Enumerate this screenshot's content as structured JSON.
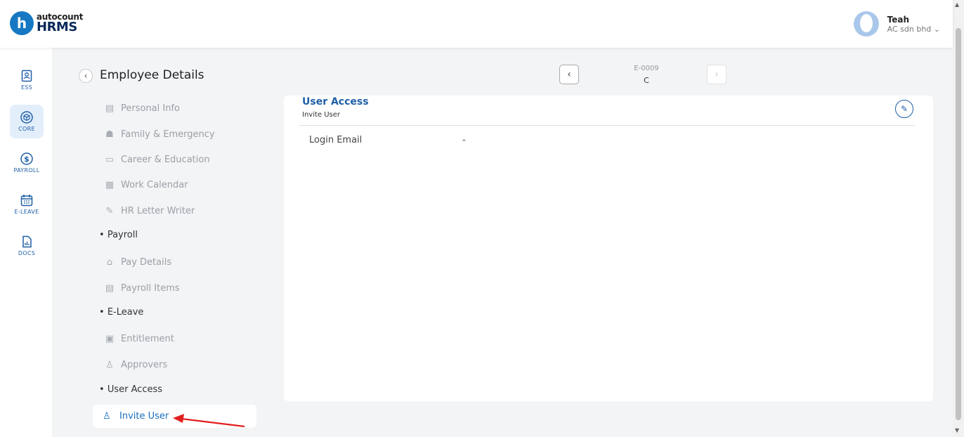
{
  "app": {
    "logo_letter": "h",
    "logo_sub": "autocount",
    "logo_main": "HRMS"
  },
  "user": {
    "name": "Teah",
    "company": "AC sdn bhd ⌄"
  },
  "rail": [
    {
      "label": "ESS",
      "icon": "ess-icon"
    },
    {
      "label": "CORE",
      "icon": "core-cube-icon",
      "active": true
    },
    {
      "label": "PAYROLL",
      "icon": "dollar-icon"
    },
    {
      "label": "E-LEAVE",
      "icon": "calendar-icon"
    },
    {
      "label": "DOCS",
      "icon": "docs-icon"
    }
  ],
  "page": {
    "title": "Employee Details"
  },
  "employee_nav": {
    "code": "E-0009",
    "name": "C"
  },
  "menu": {
    "items": [
      {
        "label": "Personal Info",
        "icon": "person-card-icon"
      },
      {
        "label": "Family & Emergency",
        "icon": "family-icon"
      },
      {
        "label": "Career & Education",
        "icon": "briefcase-icon"
      },
      {
        "label": "Work Calendar",
        "icon": "calendar-icon"
      },
      {
        "label": "HR Letter Writer",
        "icon": "edit-doc-icon"
      }
    ],
    "section_payroll": "Payroll",
    "payroll_items": [
      {
        "label": "Pay Details",
        "icon": "bank-icon"
      },
      {
        "label": "Payroll Items",
        "icon": "list-icon"
      }
    ],
    "section_eleave": "E-Leave",
    "eleave_items": [
      {
        "label": "Entitlement",
        "icon": "calendar-check-icon"
      },
      {
        "label": "Approvers",
        "icon": "user-check-icon"
      }
    ],
    "section_user_access": "User Access",
    "active_item": {
      "label": "Invite User",
      "icon": "user-invite-icon"
    }
  },
  "card": {
    "title": "User Access",
    "subtitle": "Invite User",
    "field_label": "Login Email",
    "field_value": "-"
  },
  "colors": {
    "accent": "#1f5fa6",
    "active_link": "#1a6fc0",
    "annotation_arrow": "#e02020"
  }
}
